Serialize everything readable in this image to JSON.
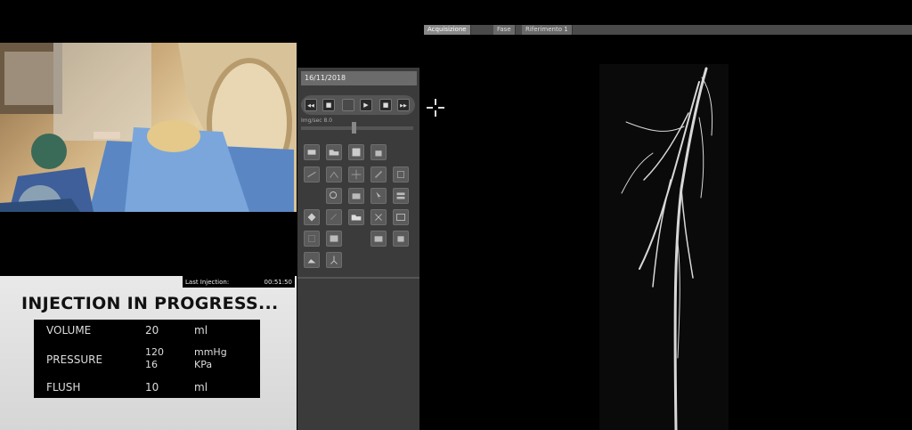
{
  "last_injection": {
    "label": "Last Injection:",
    "time": "00:51:50"
  },
  "injection": {
    "title": "INJECTION IN PROGRESS...",
    "volume": {
      "label": "VOLUME",
      "value": "20",
      "unit": "ml"
    },
    "pressure": {
      "label": "PRESSURE",
      "value1": "120",
      "unit1": "mmHg",
      "value2": "16",
      "unit2": "KPa"
    },
    "flush": {
      "label": "FLUSH",
      "value": "10",
      "unit": "ml"
    }
  },
  "control": {
    "date": "16/11/2018",
    "fps_label": "Img/sec   8.0",
    "fps_level": 0.47
  },
  "tabs": [
    "Acquisizione",
    "Fase",
    "Riferimento 1"
  ],
  "icons": {
    "play": "▶",
    "stop": "■",
    "rewind": "◀◀",
    "forward": "▶▶"
  }
}
